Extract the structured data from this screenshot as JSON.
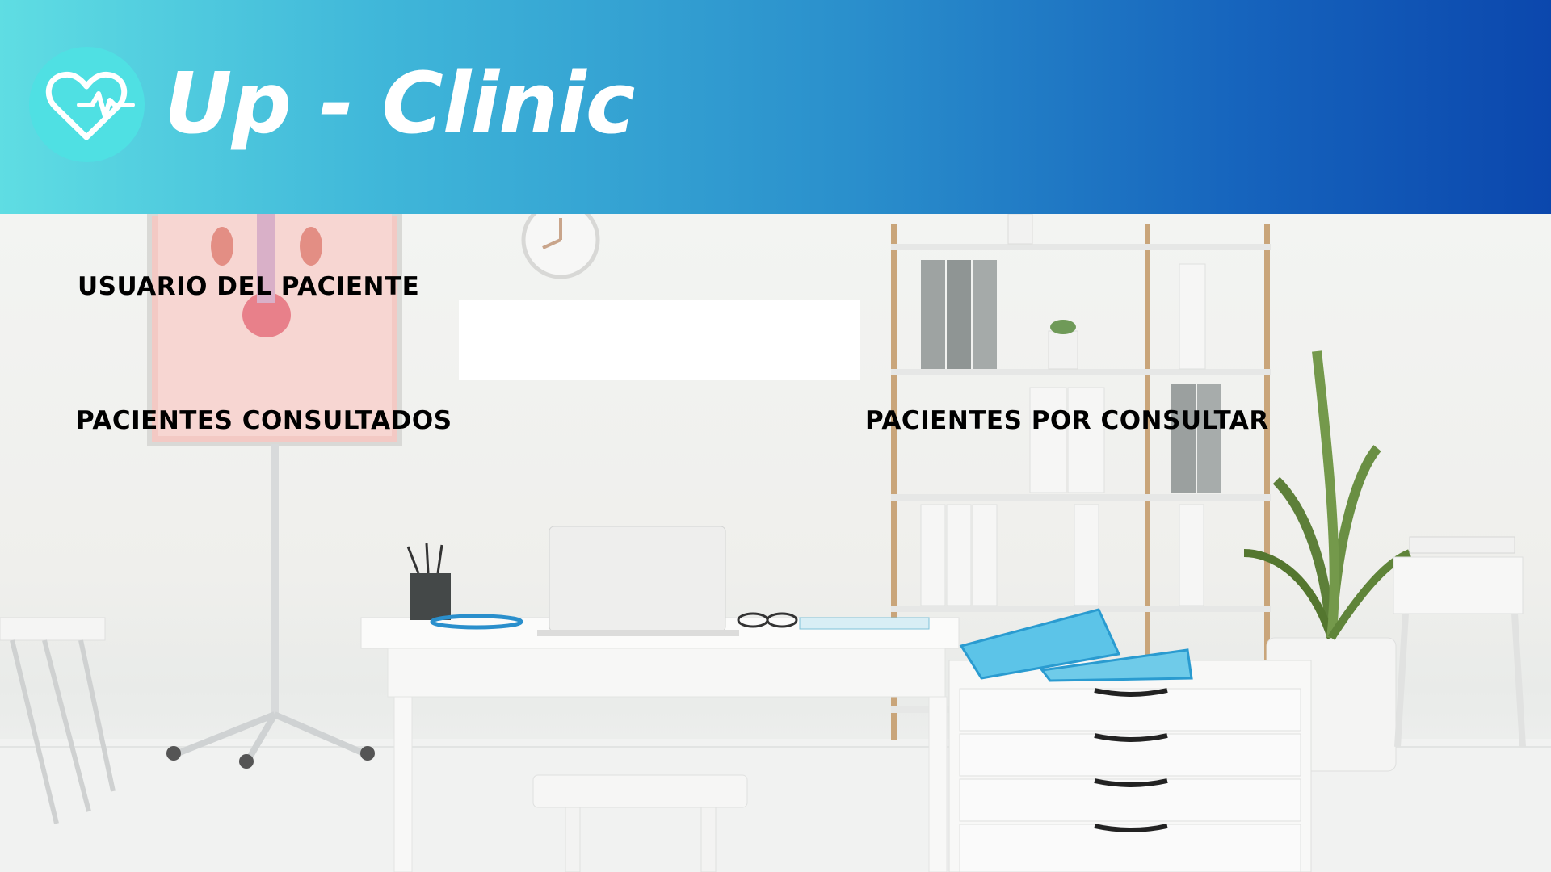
{
  "header": {
    "title": "Up - Clinic",
    "logo_icon": "heart-pulse-icon",
    "gradient_colors": [
      "#5fdde3",
      "#0b47ad"
    ]
  },
  "form": {
    "patient_user_label": "USUARIO DEL PACIENTE",
    "patient_user_value": "",
    "patient_user_placeholder": ""
  },
  "sections": {
    "consulted_label": "PACIENTES CONSULTADOS",
    "pending_label": "PACIENTES POR CONSULTAR"
  },
  "background": {
    "description_icon": "clinic-office-background"
  }
}
